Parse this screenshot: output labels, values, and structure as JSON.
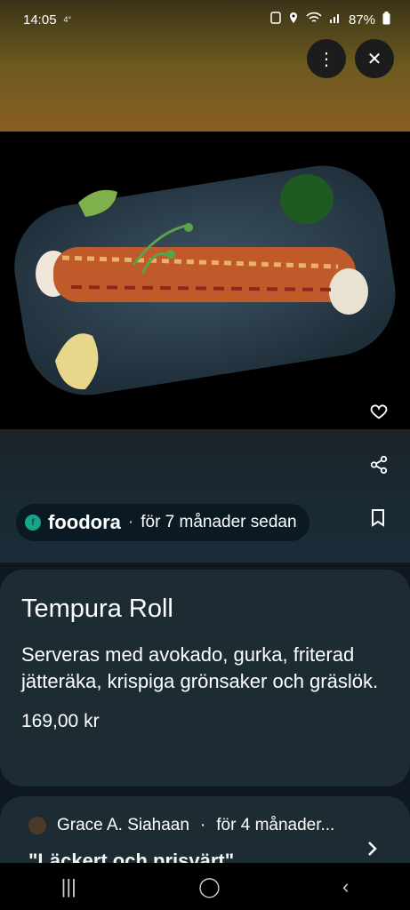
{
  "status": {
    "time": "14:05",
    "small_icon": "4°",
    "battery": "87%"
  },
  "actions": {
    "more_icon": "⋮",
    "close_icon": "✕"
  },
  "source": {
    "logo_letter": "f",
    "name": "foodora",
    "separator": "·",
    "time": "för 7 månader sedan"
  },
  "item": {
    "title": "Tempura Roll",
    "description": "Serveras med avokado, gurka, friterad jätteräka, krispiga grönsaker och gräslök.",
    "price": "169,00 kr"
  },
  "review": {
    "author": "Grace A. Siahaan",
    "separator": "·",
    "time": "för 4 månader...",
    "text": "\"Läckert och prisvärt\""
  },
  "nav": {
    "recent": "|||",
    "home": "◯",
    "back": "‹"
  }
}
